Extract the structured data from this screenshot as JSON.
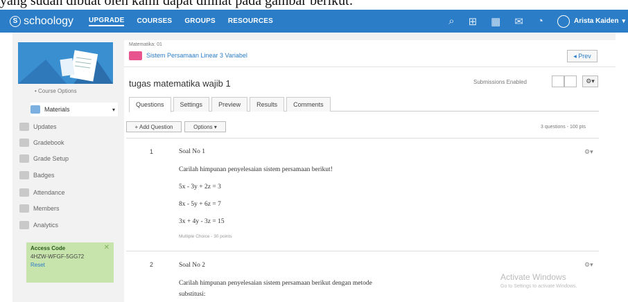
{
  "top_strip_text": "yang sudah dibuat oleh kami dapat dilihat pada gambar berikut:",
  "navbar": {
    "logo": "schoology",
    "links": [
      "UPGRADE",
      "COURSES",
      "GROUPS",
      "RESOURCES"
    ],
    "user": "Arista Kaiden"
  },
  "sidebar": {
    "course_options": "• Course Options",
    "items": [
      "Materials",
      "Updates",
      "Gradebook",
      "Grade Setup",
      "Badges",
      "Attendance",
      "Members",
      "Analytics"
    ],
    "access_code_title": "Access Code",
    "access_code": "4HZW-WFGF-5GG72",
    "reset": "Reset"
  },
  "breadcrumb": {
    "small": "Matematika: 01",
    "title": "Sistem Persamaan Linear 3 Variabel"
  },
  "prev_label": "◂ Prev",
  "main_title": "tugas matematika wajib 1",
  "submissions": "Submissions Enabled",
  "tabs": [
    "Questions",
    "Settings",
    "Preview",
    "Results",
    "Comments"
  ],
  "toolbar": {
    "add_question": "+ Add Question",
    "options": "Options ▾",
    "summary": "3 questions - 100 pts"
  },
  "questions": [
    {
      "num": "1",
      "title": "Soal No 1",
      "lines": [
        "Carilah himpunan penyelesaian sistem persamaan berikut!",
        "5x - 3y + 2z = 3",
        "8x - 5y + 6z = 7",
        "3x + 4y - 3z = 15"
      ],
      "meta": "Multiple Choice - 30 points"
    },
    {
      "num": "2",
      "title": "Soal No 2",
      "lines": [
        "Carilah himpunan penyelesaian sistem persamaan berikut dengan metode",
        "substitusi:"
      ]
    }
  ],
  "watermark": {
    "line1": "Activate Windows",
    "line2": "Go to Settings to activate Windows."
  }
}
